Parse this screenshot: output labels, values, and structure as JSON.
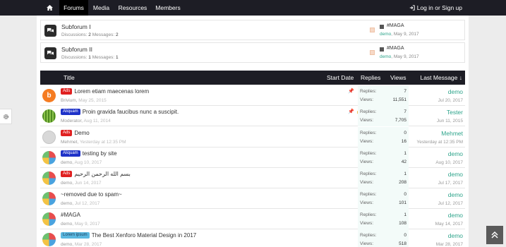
{
  "nav": {
    "home_icon": "home-icon",
    "tabs": [
      {
        "label": "Forums",
        "active": true
      },
      {
        "label": "Media",
        "active": false
      },
      {
        "label": "Resources",
        "active": false
      },
      {
        "label": "Members",
        "active": false
      }
    ],
    "login_label": "Log in or Sign up"
  },
  "subforums": [
    {
      "title": "Subforum I",
      "discussions_label": "Discussions:",
      "discussions": "2",
      "messages_label": "Messages:",
      "messages": "2",
      "last_title": "#MAGA",
      "last_user": "demo",
      "last_date": "May 9, 2017"
    },
    {
      "title": "Subforum II",
      "discussions_label": "Discussions:",
      "discussions": "1",
      "messages_label": "Messages:",
      "messages": "1",
      "last_title": "#MAGA",
      "last_user": "demo",
      "last_date": "May 9, 2017"
    }
  ],
  "table": {
    "headers": {
      "title": "Title",
      "start_date": "Start Date",
      "replies": "Replies",
      "views": "Views",
      "last_message": "Last Message ↓"
    },
    "replies_label": "Replies:",
    "views_label": "Views:",
    "rows": [
      {
        "prefix": "Ads",
        "prefix_style": "ads",
        "title": "Lorem etiam maecenas lorem",
        "author": "Brivium",
        "date": "May 25, 2015",
        "replies": "7",
        "views": "11,551",
        "last_user": "demo",
        "last_date": "Jul 20, 2017",
        "pinned": true,
        "locked": false,
        "avatar": "orange"
      },
      {
        "prefix": "Aliquam",
        "prefix_style": "aliquam",
        "title": "Proin gravida faucibus nunc a suscipit.",
        "author": "Moderator",
        "date": "Aug 11, 2014",
        "replies": "7",
        "views": "7,705",
        "last_user": "Tester",
        "last_date": "Jun 11, 2015",
        "pinned": true,
        "locked": true,
        "avatar": "green"
      },
      {
        "prefix": "Ads",
        "prefix_style": "ads",
        "title": "Demo",
        "author": "Mehmet",
        "date": "Yesterday at 12:35 PM",
        "replies": "0",
        "views": "16",
        "last_user": "Mehmet",
        "last_date": "Yesterday at 12:35 PM",
        "pinned": false,
        "locked": false,
        "avatar": "grey"
      },
      {
        "prefix": "Aliquam",
        "prefix_style": "aliquam",
        "title": "testing by site",
        "author": "demo",
        "date": "Aug 10, 2017",
        "replies": "1",
        "views": "42",
        "last_user": "demo",
        "last_date": "Aug 10, 2017",
        "pinned": false,
        "locked": false,
        "avatar": "multi"
      },
      {
        "prefix": "Ads",
        "prefix_style": "ads",
        "title": "بسم الله الرحمن الرحيم",
        "author": "demo",
        "date": "Jun 14, 2017",
        "replies": "1",
        "views": "208",
        "last_user": "demo",
        "last_date": "Jul 17, 2017",
        "pinned": false,
        "locked": false,
        "avatar": "multi"
      },
      {
        "prefix": "",
        "prefix_style": "",
        "title": "~removed due to spam~",
        "author": "demo",
        "date": "Jul 12, 2017",
        "replies": "0",
        "views": "101",
        "last_user": "demo",
        "last_date": "Jul 12, 2017",
        "pinned": false,
        "locked": false,
        "avatar": "multi"
      },
      {
        "prefix": "",
        "prefix_style": "",
        "title": "#MAGA",
        "author": "demo",
        "date": "May 9, 2017",
        "replies": "1",
        "views": "108",
        "last_user": "demo",
        "last_date": "May 14, 2017",
        "pinned": false,
        "locked": false,
        "avatar": "multi"
      },
      {
        "prefix": "Lorem ipsum",
        "prefix_style": "lorem",
        "title": "The Best Xenforo Material Design in 2017",
        "author": "demo",
        "date": "Mar 28, 2017",
        "replies": "0",
        "views": "518",
        "last_user": "demo",
        "last_date": "Mar 28, 2017",
        "pinned": false,
        "locked": false,
        "avatar": "multi"
      }
    ]
  },
  "colors": {
    "nav_bg": "#1d1d25",
    "accent_green": "#2ea48b",
    "prefix_ads": "#e02020",
    "prefix_aliquam": "#1e32c8",
    "prefix_lorem": "#5bb8e0"
  },
  "widgets": {
    "settings_icon": "gear-icon",
    "scroll_icon": "double-chevron-up-icon"
  }
}
